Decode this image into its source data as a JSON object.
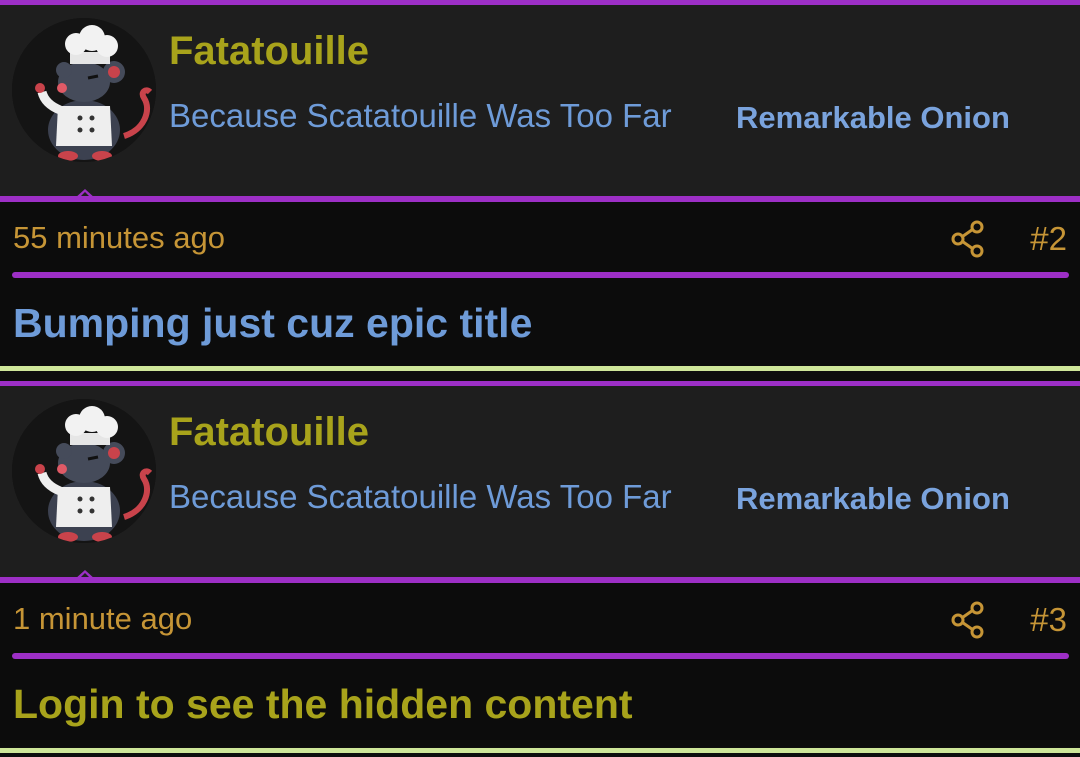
{
  "colors": {
    "accent_purple": "#9d2fc6",
    "username_olive": "#a8a31b",
    "user_title_blue": "#6e9bd8",
    "meta_gold": "#c69536",
    "divider_green": "#cfe79a"
  },
  "posts": [
    {
      "author": {
        "avatar": "chef-rat-avatar",
        "name": "Fatatouille",
        "title": "Because Scatatouille Was Too Far",
        "rank": "Remarkable Onion"
      },
      "timestamp": "55 minutes ago",
      "share_icon": "share-icon",
      "post_number": "#2",
      "content": "Bumping just cuz epic title",
      "content_color": "#6e9bd8"
    },
    {
      "author": {
        "avatar": "chef-rat-avatar",
        "name": "Fatatouille",
        "title": "Because Scatatouille Was Too Far",
        "rank": "Remarkable Onion"
      },
      "timestamp": "1 minute ago",
      "share_icon": "share-icon",
      "post_number": "#3",
      "content": "Login to see the hidden content",
      "content_color": "#a8a31b"
    }
  ]
}
